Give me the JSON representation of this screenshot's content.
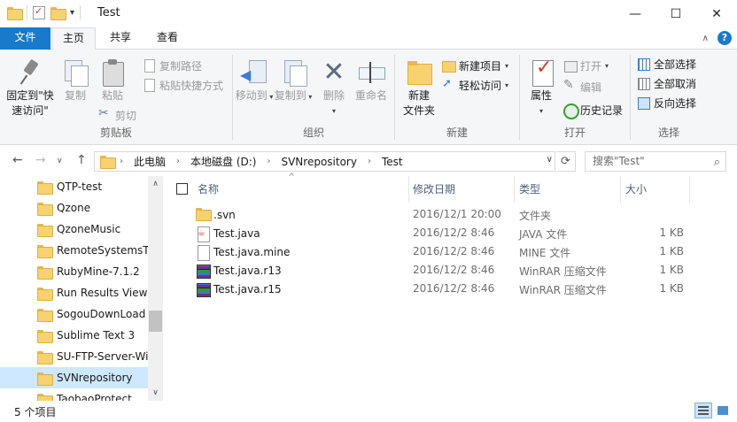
{
  "window": {
    "title": "Test",
    "minimize_glyph": "—",
    "maximize_glyph": "☐",
    "close_glyph": "✕"
  },
  "ribbon_tabs": {
    "file": "文件",
    "home": "主页",
    "share": "共享",
    "view": "查看",
    "help_glyph": "?"
  },
  "ribbon": {
    "clipboard": {
      "label": "剪贴板",
      "pin": "固定到\"快速访问\"",
      "pin_line1": "固定到\"快",
      "pin_line2": "速访问\"",
      "copy": "复制",
      "paste": "粘贴",
      "copy_path": "复制路径",
      "paste_shortcut": "粘贴快捷方式",
      "cut": "剪切"
    },
    "organize": {
      "label": "组织",
      "move_to": "移动到",
      "copy_to": "复制到",
      "delete": "删除",
      "rename": "重命名"
    },
    "new": {
      "label": "新建",
      "new_folder_line1": "新建",
      "new_folder_line2": "文件夹",
      "new_item": "新建项目",
      "easy_access": "轻松访问"
    },
    "open": {
      "label": "打开",
      "properties": "属性",
      "open": "打开",
      "edit": "编辑",
      "history": "历史记录"
    },
    "select": {
      "label": "选择",
      "select_all": "全部选择",
      "select_none": "全部取消",
      "invert": "反向选择"
    }
  },
  "address": {
    "segments": [
      "此电脑",
      "本地磁盘 (D:)",
      "SVNrepository",
      "Test"
    ],
    "search_placeholder": "搜索\"Test\""
  },
  "nav_pane": {
    "items": [
      {
        "label": "QTP-test",
        "selected": false
      },
      {
        "label": "Qzone",
        "selected": false
      },
      {
        "label": "QzoneMusic",
        "selected": false
      },
      {
        "label": "RemoteSystemsTe",
        "selected": false
      },
      {
        "label": "RubyMine-7.1.2",
        "selected": false
      },
      {
        "label": "Run Results Viewe",
        "selected": false
      },
      {
        "label": "SogouDownLoad",
        "selected": false
      },
      {
        "label": "Sublime Text 3",
        "selected": false
      },
      {
        "label": "SU-FTP-Server-Wir",
        "selected": false
      },
      {
        "label": "SVNrepository",
        "selected": true
      },
      {
        "label": "TaobaoProtect",
        "selected": false
      }
    ]
  },
  "file_list": {
    "columns": {
      "name": "名称",
      "date": "修改日期",
      "type": "类型",
      "size": "大小"
    },
    "rows": [
      {
        "name": ".svn",
        "date": "2016/12/1 20:00",
        "type": "文件夹",
        "size": "",
        "icon": "folder-icon"
      },
      {
        "name": "Test.java",
        "date": "2016/12/2 8:46",
        "type": "JAVA 文件",
        "size": "1 KB",
        "icon": "java-file-icon"
      },
      {
        "name": "Test.java.mine",
        "date": "2016/12/2 8:46",
        "type": "MINE 文件",
        "size": "1 KB",
        "icon": "document-icon"
      },
      {
        "name": "Test.java.r13",
        "date": "2016/12/2 8:46",
        "type": "WinRAR 压缩文件",
        "size": "1 KB",
        "icon": "winrar-icon"
      },
      {
        "name": "Test.java.r15",
        "date": "2016/12/2 8:46",
        "type": "WinRAR 压缩文件",
        "size": "1 KB",
        "icon": "winrar-icon"
      }
    ]
  },
  "status": {
    "item_count": "5 个项目"
  }
}
